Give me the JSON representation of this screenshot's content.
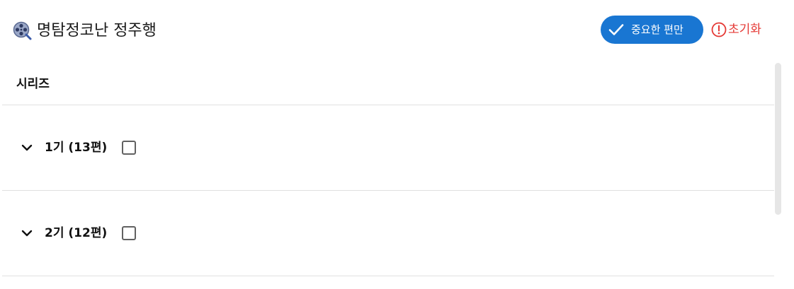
{
  "header": {
    "title": "명탐정코난 정주행",
    "icon": "film-reel-magnifier-icon",
    "important_button_label": "중요한 편만",
    "important_button_icon": "check-icon",
    "reset_label": "초기화",
    "reset_icon": "alert-circle-icon"
  },
  "list": {
    "column_title": "시리즈",
    "seasons": [
      {
        "label": "1기 (13편)",
        "checked": false,
        "expanded": false
      },
      {
        "label": "2기 (12편)",
        "checked": false,
        "expanded": false
      }
    ]
  },
  "colors": {
    "primary": "#1976d2",
    "danger": "#e53935",
    "divider": "#e0e0e0",
    "text": "#111111"
  }
}
